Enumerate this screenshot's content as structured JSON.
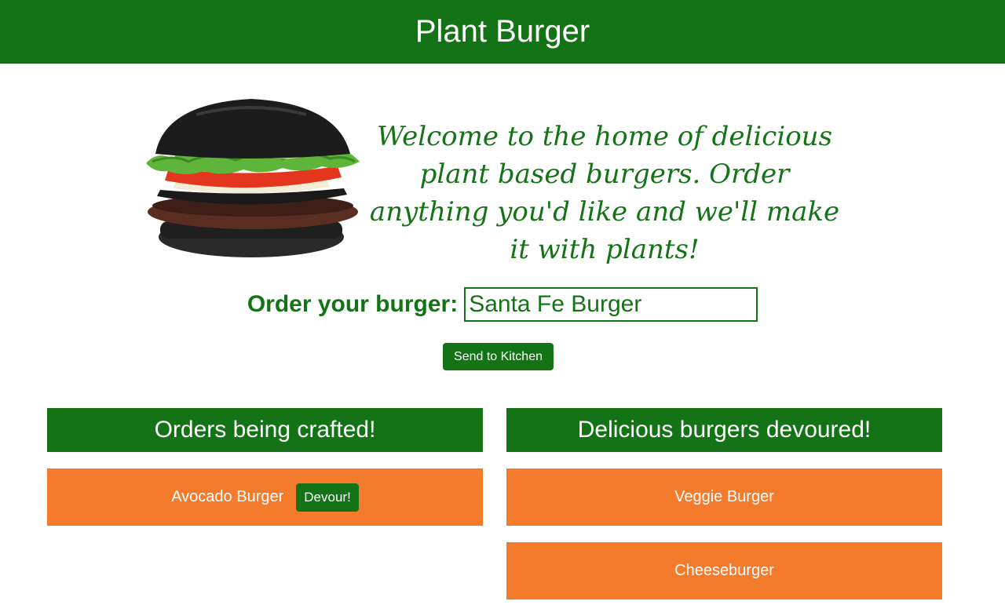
{
  "header": {
    "title": "Plant Burger"
  },
  "hero": {
    "welcome_text": "Welcome to the home of delicious plant based burgers. Order anything you'd like and we'll make it with plants!"
  },
  "order": {
    "label": "Order your burger:",
    "input_value": "Santa Fe Burger",
    "send_button": "Send to Kitchen"
  },
  "crafted": {
    "title": "Orders being crafted!",
    "items": [
      {
        "name": "Avocado Burger",
        "button": "Devour!"
      }
    ]
  },
  "devoured": {
    "title": "Delicious burgers devoured!",
    "items": [
      {
        "name": "Veggie Burger"
      },
      {
        "name": "Cheeseburger"
      }
    ]
  },
  "colors": {
    "brand_green": "#157317",
    "card_orange": "#f47a2c"
  }
}
